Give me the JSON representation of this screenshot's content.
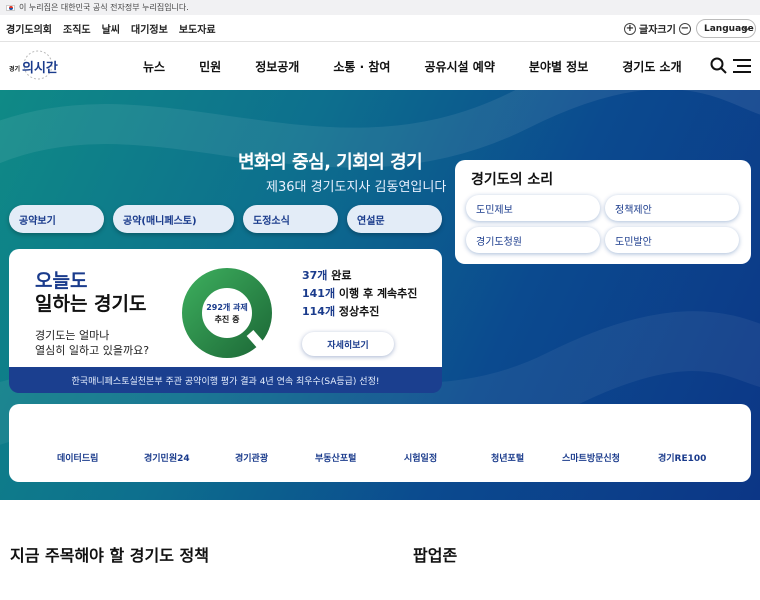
{
  "gov_banner": {
    "text": "이 누리집은 대한민국 공식 전자정부 누리집입니다."
  },
  "utility": {
    "links": [
      "경기도의회",
      "조직도",
      "날씨",
      "대기정보",
      "보도자료"
    ],
    "font_size_label": "글자크기",
    "font_plus": "+",
    "font_minus": "−",
    "language": "Language"
  },
  "nav": {
    "logo_text": "경기의 시간",
    "menu": [
      "뉴스",
      "민원",
      "정보공개",
      "소통 · 참여",
      "공유시설 예약",
      "분야별 정보",
      "경기도 소개"
    ]
  },
  "hero": {
    "slogan": "변화의 중심, 기회의 경기",
    "subtitle": "제36대 경기도지사 김동연입니다",
    "pills": [
      "공약보기",
      "공약(매니페스토)",
      "도정소식",
      "연설문"
    ]
  },
  "voice": {
    "title": "경기도의 소리",
    "buttons": [
      "도민제보",
      "정책제안",
      "경기도청원",
      "도민발안"
    ]
  },
  "card": {
    "title1": "오늘도",
    "title2": "일하는 경기도",
    "question1": "경기도는 얼마나",
    "question2": "열심히 일하고 있을까요?",
    "donut_label1": "292개 과제",
    "donut_label2": "추진 중",
    "stats": [
      {
        "num": "37개",
        "text": " 완료"
      },
      {
        "num": "141개",
        "text": " 이행 후 계속추진"
      },
      {
        "num": "114개",
        "text": " 정상추진"
      }
    ],
    "more": "자세히보기",
    "banner": "한국매니페스토실천본부 주관 공약이행 평가 결과 4년 연속 최우수(SA등급) 선정!"
  },
  "links": [
    "데이터드림",
    "경기민원24",
    "경기관광",
    "부동산포털",
    "시험일정",
    "청년포털",
    "스마트방문신청",
    "경기RE100"
  ],
  "sections": {
    "policy_title": "지금 주목해야 할 경기도 정책",
    "popup_title": "팝업존"
  },
  "colors": {
    "accent": "#1a3b8c",
    "teal": "#0f8a86",
    "donut": "#2e8a46"
  }
}
